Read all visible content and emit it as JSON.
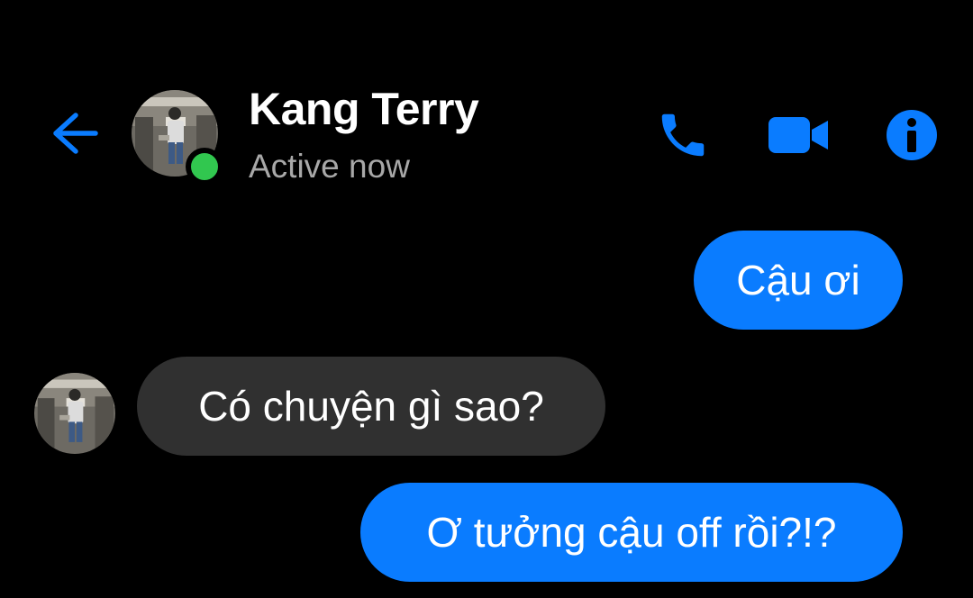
{
  "header": {
    "contact_name": "Kang Terry",
    "status": "Active now",
    "back_icon": "arrow-left-icon",
    "call_icon": "phone-icon",
    "video_icon": "video-camera-icon",
    "info_icon": "info-icon",
    "presence": "online"
  },
  "messages": [
    {
      "direction": "outgoing",
      "text": "Cậu ơi"
    },
    {
      "direction": "incoming",
      "text": "Có chuyện gì sao?"
    },
    {
      "direction": "outgoing",
      "text": "Ơ tưởng cậu off rồi?!?"
    }
  ],
  "colors": {
    "accent": "#0a7cff",
    "background": "#000000",
    "incoming_bubble": "#303030",
    "presence": "#31c74f",
    "status_text": "#a8a8a8"
  }
}
